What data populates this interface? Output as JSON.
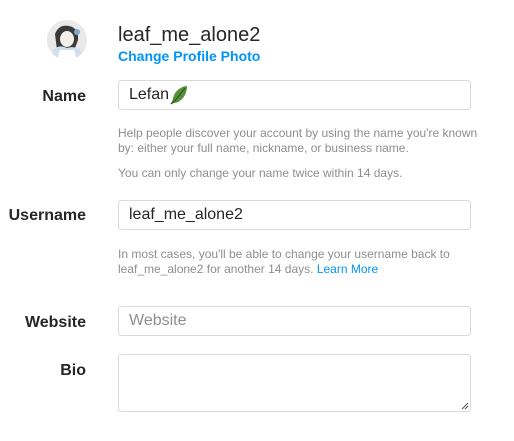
{
  "profile": {
    "username": "leaf_me_alone2",
    "change_photo_label": "Change Profile Photo"
  },
  "name": {
    "label": "Name",
    "value": "Lefan",
    "emoji_icon": "leaf-icon",
    "help": "Help people discover your account by using the name you're known by: either your full name, nickname, or business name.",
    "note": "You can only change your name twice within 14 days."
  },
  "username": {
    "label": "Username",
    "value": "leaf_me_alone2",
    "help": "In most cases, you'll be able to change your username back to leaf_me_alone2 for another 14 days.",
    "learn_more": "Learn More"
  },
  "website": {
    "label": "Website",
    "placeholder": "Website",
    "value": ""
  },
  "bio": {
    "label": "Bio",
    "value": ""
  },
  "colors": {
    "accent": "#0095f6",
    "border": "#dbdbdb",
    "muted": "#8e8e8e",
    "text": "#262626"
  }
}
